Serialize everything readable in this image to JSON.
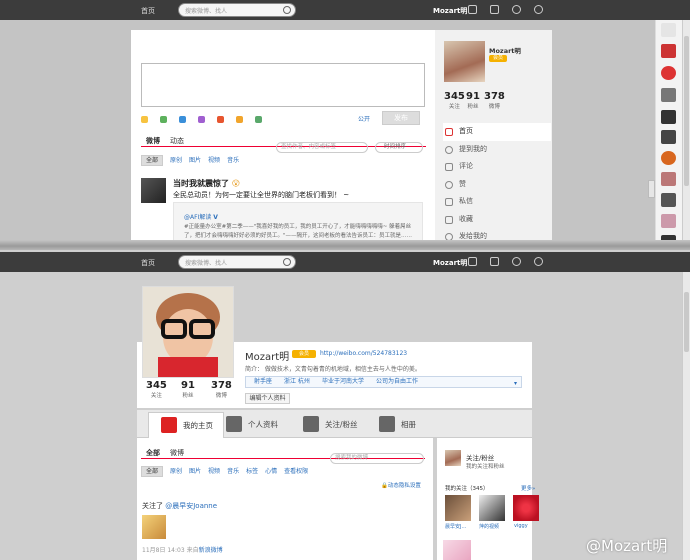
{
  "topbar": {
    "home": "首页",
    "search_placeholder": "搜索微博、找人",
    "user": "Mozart明"
  },
  "upper": {
    "composer": {
      "visibility": "公开",
      "post_button": "发布"
    },
    "feed_tabs": [
      "微博",
      "动态"
    ],
    "filters": [
      "全部",
      "原创",
      "图片",
      "视频",
      "音乐"
    ],
    "feed_search_placeholder": "查找作者、内容或标签",
    "sort_label": "时间排序",
    "post": {
      "title": "当时我就震惊了",
      "text": "全民总动员！为何一定要让全世界的脑门老板们看到！ ~",
      "quote_author": "@AFI解读",
      "quote_text": "#正能量办公室#第二季——\"我喜好我的员工，我的员工开心了，才能嗨嗨嗨嗨嗨~ 躲着屌丝了，把们才会嗨嗨嗨好好必须的好员工。\"——隔开，这间老板的看法告诉员工：员工就是……"
    },
    "profile": {
      "name": "Mozart明",
      "badge": "会员",
      "stats": [
        {
          "value": "345",
          "label": "关注"
        },
        {
          "value": "91",
          "label": "粉丝"
        },
        {
          "value": "378",
          "label": "微博"
        }
      ]
    },
    "nav": [
      {
        "label": "首页",
        "selected": true
      },
      {
        "label": "提到我的",
        "selected": false
      },
      {
        "label": "评论",
        "selected": false
      },
      {
        "label": "赞",
        "selected": false
      },
      {
        "label": "私信",
        "selected": false
      },
      {
        "label": "收藏",
        "selected": false
      },
      {
        "label": "发给我的",
        "selected": false
      }
    ]
  },
  "lower": {
    "profile": {
      "name": "Mozart明",
      "badge": "会员",
      "url": "http://weibo.com/524783123",
      "intro": "简介： 做做技术，文青勾着青的机地域，相信主去与人性中的美。",
      "tags": [
        "射手座",
        "浙江 杭州",
        "毕业于河南大学",
        "公司为自由工作"
      ],
      "edit_button": "编辑个人资料",
      "stats": [
        {
          "value": "345",
          "label": "关注"
        },
        {
          "value": "91",
          "label": "粉丝"
        },
        {
          "value": "378",
          "label": "微博"
        }
      ]
    },
    "tabs": [
      "我的主页",
      "个人资料",
      "关注/粉丝",
      "相册"
    ],
    "feed_tabs": [
      "全部",
      "微博"
    ],
    "filters": [
      "全部",
      "原创",
      "图片",
      "视频",
      "音乐",
      "标签",
      "心情",
      "查看权限"
    ],
    "feed_search_placeholder": "搜索我的微博",
    "privacy_link": "动态隐私设置",
    "activity": {
      "text_prefix": "关注了",
      "target": "@晨早安Joanne",
      "time": "11月8日 14:03",
      "source_prefix": "来自",
      "source": "新浪微博"
    },
    "side": {
      "title": "关注/粉丝",
      "subtitle": "我的关注和粉丝",
      "my_follow": "我的关注（345）",
      "more": "更多»",
      "thumbs": [
        "晨早安J...",
        "萍的视频",
        "viggy"
      ]
    }
  },
  "watermark": "@Mozart明"
}
